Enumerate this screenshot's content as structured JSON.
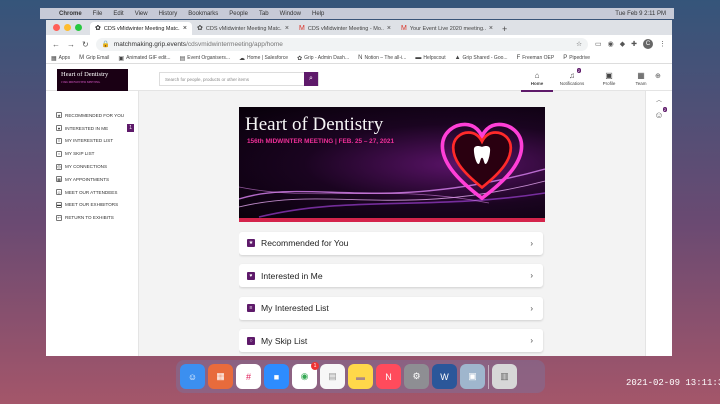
{
  "menubar": {
    "items": [
      "Chrome",
      "File",
      "Edit",
      "View",
      "History",
      "Bookmarks",
      "People",
      "Tab",
      "Window",
      "Help"
    ],
    "clock": "Tue Feb 9  2:11 PM"
  },
  "tabs": [
    {
      "label": "CDS vMidwinter Meeting Matc...",
      "favicon": "grip-icon",
      "active": true
    },
    {
      "label": "CDS vMidwinter Meeting Matc...",
      "favicon": "grip-icon",
      "active": false
    },
    {
      "label": "CDS vMidwinter Meeting - Mo...",
      "favicon": "gmail-icon",
      "active": false
    },
    {
      "label": "Your Event Live 2020 meeting...",
      "favicon": "gmail-icon",
      "active": false
    }
  ],
  "address": {
    "domain": "matchmaking.grip.events",
    "path": "/cdsvmidwintermeeting/app/home"
  },
  "bookmarks": [
    "Apps",
    "Grip Email",
    "Animated GIF edit...",
    "Event Organisers...",
    "Home | Salesforce",
    "Grip - Admin Dash...",
    "Notion – The all-i...",
    "Helpscout",
    "Grip Shared - Goo...",
    "Freeman OEP",
    "Pipedrive"
  ],
  "logo": {
    "title": "Heart of Dentistry",
    "subtitle": "156th MIDWINTER MEETING"
  },
  "search": {
    "placeholder": "Search for people, products or other items"
  },
  "nav": [
    {
      "label": "Home",
      "icon": "home-icon",
      "badge": ""
    },
    {
      "label": "Notifications",
      "icon": "bell-icon",
      "badge": "2"
    },
    {
      "label": "Profile",
      "icon": "profile-icon",
      "badge": ""
    },
    {
      "label": "Team",
      "icon": "team-icon",
      "badge": ""
    }
  ],
  "sidebar": [
    {
      "label": "RECOMMENDED FOR YOU",
      "count": ""
    },
    {
      "label": "INTERESTED IN ME",
      "count": "1"
    },
    {
      "label": "MY INTERESTED LIST",
      "count": ""
    },
    {
      "label": "MY SKIP LIST",
      "count": ""
    },
    {
      "label": "MY CONNECTIONS",
      "count": ""
    },
    {
      "label": "MY APPOINTMENTS",
      "count": ""
    },
    {
      "label": "MEET OUR ATTENDEES",
      "count": ""
    },
    {
      "label": "MEET OUR EXHIBITORS",
      "count": ""
    },
    {
      "label": "RETURN TO EXHIBITS",
      "count": ""
    }
  ],
  "banner": {
    "title": "Heart of Dentistry",
    "meeting": "156th MIDWINTER MEETING | FEB. 25 – 27, 2021"
  },
  "cards": [
    "Recommended for You",
    "Interested in Me",
    "My Interested List",
    "My Skip List"
  ],
  "rightpanel": {
    "badge": "2"
  },
  "dock": {
    "chrome_badge": "1"
  },
  "timestamp": "2021-02-09  13:11:34",
  "colors": {
    "accent": "#5e1a6a",
    "banner_pink": "#ee2f98"
  }
}
